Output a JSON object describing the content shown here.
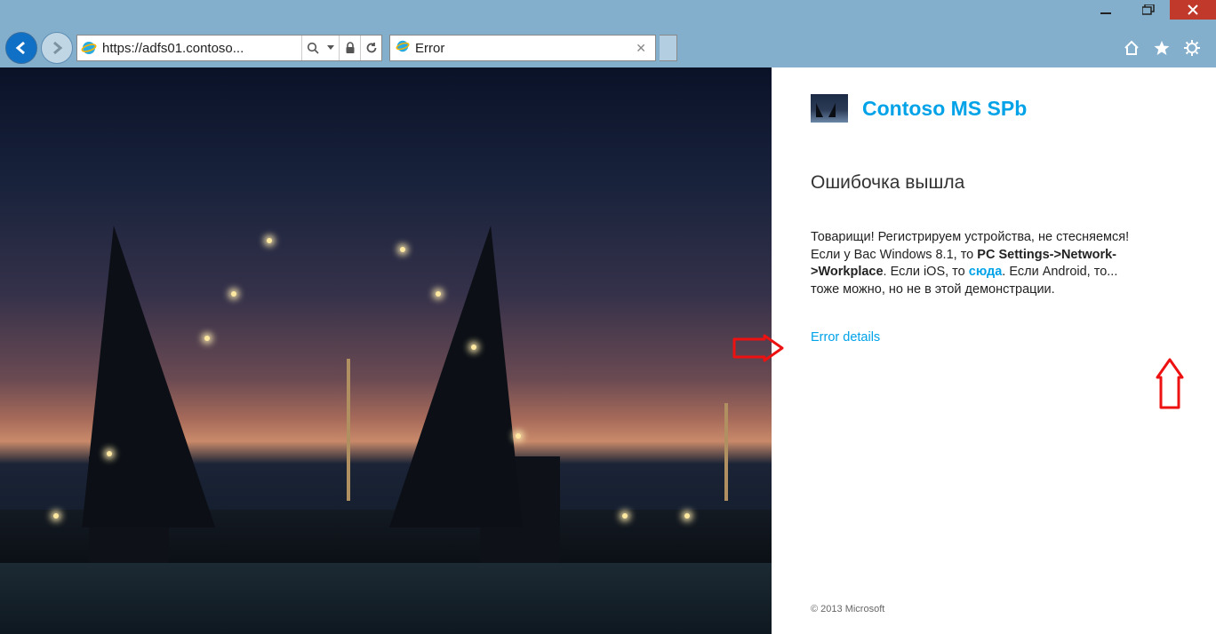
{
  "window": {
    "minimize_tip": "Minimize",
    "maximize_tip": "Restore",
    "close_tip": "Close"
  },
  "nav": {
    "url": "https://adfs01.contoso...",
    "search_icon": "search",
    "lock_icon": "lock",
    "refresh_icon": "refresh",
    "tab_title": "Error",
    "home_tip": "Home",
    "fav_tip": "Favorites",
    "tools_tip": "Tools"
  },
  "side": {
    "brand_title": "Contoso MS SPb",
    "heading": "Ошибочка вышла",
    "body_part1": "Товарищи! Регистрируем устройства, не стесняемся! Если у Вас Windows 8.1, то ",
    "body_bold": "PC Settings->Network->Workplace",
    "body_part2": ". Если iOS, то ",
    "body_link": "сюда",
    "body_part3": ". Если Android, то... тоже можно, но не в этой демонстрации.",
    "error_details": "Error details",
    "copyright": "© 2013 Microsoft"
  }
}
